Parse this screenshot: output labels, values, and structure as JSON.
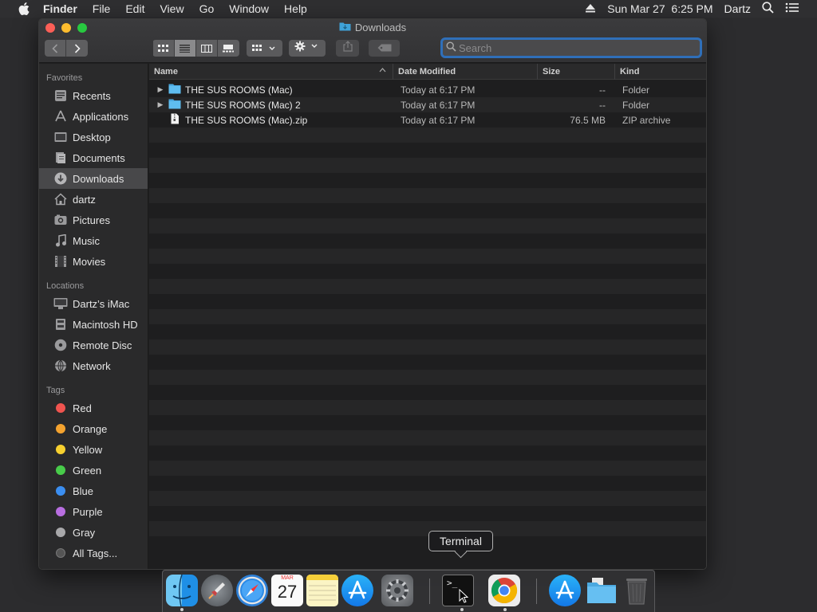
{
  "menubar": {
    "app_name": "Finder",
    "menus": [
      "File",
      "Edit",
      "View",
      "Go",
      "Window",
      "Help"
    ],
    "datetime": "Sun Mar 27  6:25 PM",
    "user": "Dartz"
  },
  "window": {
    "title": "Downloads",
    "search_placeholder": "Search"
  },
  "sidebar": {
    "favorites_header": "Favorites",
    "favorites": [
      {
        "label": "Recents",
        "icon": "recents-icon"
      },
      {
        "label": "Applications",
        "icon": "applications-icon"
      },
      {
        "label": "Desktop",
        "icon": "desktop-icon"
      },
      {
        "label": "Documents",
        "icon": "documents-icon"
      },
      {
        "label": "Downloads",
        "icon": "downloads-icon",
        "selected": true
      },
      {
        "label": "dartz",
        "icon": "home-icon"
      },
      {
        "label": "Pictures",
        "icon": "pictures-icon"
      },
      {
        "label": "Music",
        "icon": "music-icon"
      },
      {
        "label": "Movies",
        "icon": "movies-icon"
      }
    ],
    "locations_header": "Locations",
    "locations": [
      {
        "label": "Dartz’s iMac",
        "icon": "imac-icon"
      },
      {
        "label": "Macintosh HD",
        "icon": "hard-drive-icon"
      },
      {
        "label": "Remote Disc",
        "icon": "disc-icon"
      },
      {
        "label": "Network",
        "icon": "network-icon"
      }
    ],
    "tags_header": "Tags",
    "tags": [
      {
        "label": "Red",
        "color": "#f0544f"
      },
      {
        "label": "Orange",
        "color": "#f4a32f"
      },
      {
        "label": "Yellow",
        "color": "#f7d02f"
      },
      {
        "label": "Green",
        "color": "#48cc4a"
      },
      {
        "label": "Blue",
        "color": "#3b8ef0"
      },
      {
        "label": "Purple",
        "color": "#b86ee0"
      },
      {
        "label": "Gray",
        "color": "#a8a8aa"
      }
    ],
    "all_tags": "All Tags..."
  },
  "columns": {
    "name": "Name",
    "date": "Date Modified",
    "size": "Size",
    "kind": "Kind"
  },
  "files": [
    {
      "name": "THE SUS ROOMS (Mac)",
      "date": "Today at 6:17 PM",
      "size": "--",
      "kind": "Folder",
      "type": "folder"
    },
    {
      "name": "THE SUS ROOMS (Mac) 2",
      "date": "Today at 6:17 PM",
      "size": "--",
      "kind": "Folder",
      "type": "folder"
    },
    {
      "name": "THE SUS ROOMS (Mac).zip",
      "date": "Today at 6:17 PM",
      "size": "76.5 MB",
      "kind": "ZIP archive",
      "type": "zip"
    }
  ],
  "tooltip": "Terminal",
  "dock": {
    "calendar_month": "MAR",
    "calendar_day": "27"
  }
}
